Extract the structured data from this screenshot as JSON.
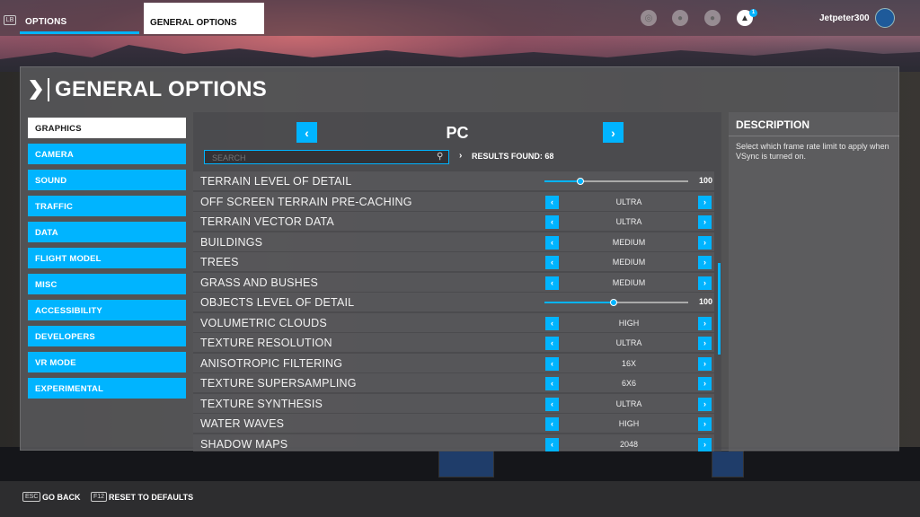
{
  "topbar": {
    "lb_key": "LB",
    "options_tab": "OPTIONS",
    "general_tab": "GENERAL OPTIONS",
    "notification_count": "1",
    "username": "Jetpeter300"
  },
  "panel": {
    "title": "GENERAL OPTIONS"
  },
  "sidebar": {
    "items": [
      {
        "label": "GRAPHICS",
        "active": true
      },
      {
        "label": "CAMERA"
      },
      {
        "label": "SOUND"
      },
      {
        "label": "TRAFFIC"
      },
      {
        "label": "DATA"
      },
      {
        "label": "FLIGHT MODEL"
      },
      {
        "label": "MISC"
      },
      {
        "label": "ACCESSIBILITY"
      },
      {
        "label": "DEVELOPERS"
      },
      {
        "label": "VR MODE"
      },
      {
        "label": "EXPERIMENTAL"
      }
    ]
  },
  "settings": {
    "platform": "PC",
    "search_placeholder": "SEARCH",
    "results": "RESULTS FOUND: 68",
    "rows": [
      {
        "label": "TERRAIN LEVEL OF DETAIL",
        "type": "slider",
        "value": "100",
        "fraction": 0.25
      },
      {
        "label": "OFF SCREEN TERRAIN PRE-CACHING",
        "type": "select",
        "value": "ULTRA"
      },
      {
        "label": "TERRAIN VECTOR DATA",
        "type": "select",
        "value": "ULTRA"
      },
      {
        "label": "BUILDINGS",
        "type": "select",
        "value": "MEDIUM"
      },
      {
        "label": "TREES",
        "type": "select",
        "value": "MEDIUM"
      },
      {
        "label": "GRASS AND BUSHES",
        "type": "select",
        "value": "MEDIUM"
      },
      {
        "label": "OBJECTS LEVEL OF DETAIL",
        "type": "slider",
        "value": "100",
        "fraction": 0.48
      },
      {
        "label": "VOLUMETRIC CLOUDS",
        "type": "select",
        "value": "HIGH"
      },
      {
        "label": "TEXTURE RESOLUTION",
        "type": "select",
        "value": "ULTRA"
      },
      {
        "label": "ANISOTROPIC FILTERING",
        "type": "select",
        "value": "16X"
      },
      {
        "label": "TEXTURE SUPERSAMPLING",
        "type": "select",
        "value": "6X6"
      },
      {
        "label": "TEXTURE SYNTHESIS",
        "type": "select",
        "value": "ULTRA"
      },
      {
        "label": "WATER WAVES",
        "type": "select",
        "value": "HIGH"
      },
      {
        "label": "SHADOW MAPS",
        "type": "select",
        "value": "2048"
      }
    ]
  },
  "description": {
    "title": "DESCRIPTION",
    "text": "Select which frame rate limit to apply when VSync is turned on."
  },
  "bottombar": {
    "esc_key": "ESC",
    "go_back": "GO BACK",
    "f12_key": "F12",
    "reset": "RESET TO DEFAULTS"
  },
  "colors": {
    "accent": "#00b4ff"
  }
}
